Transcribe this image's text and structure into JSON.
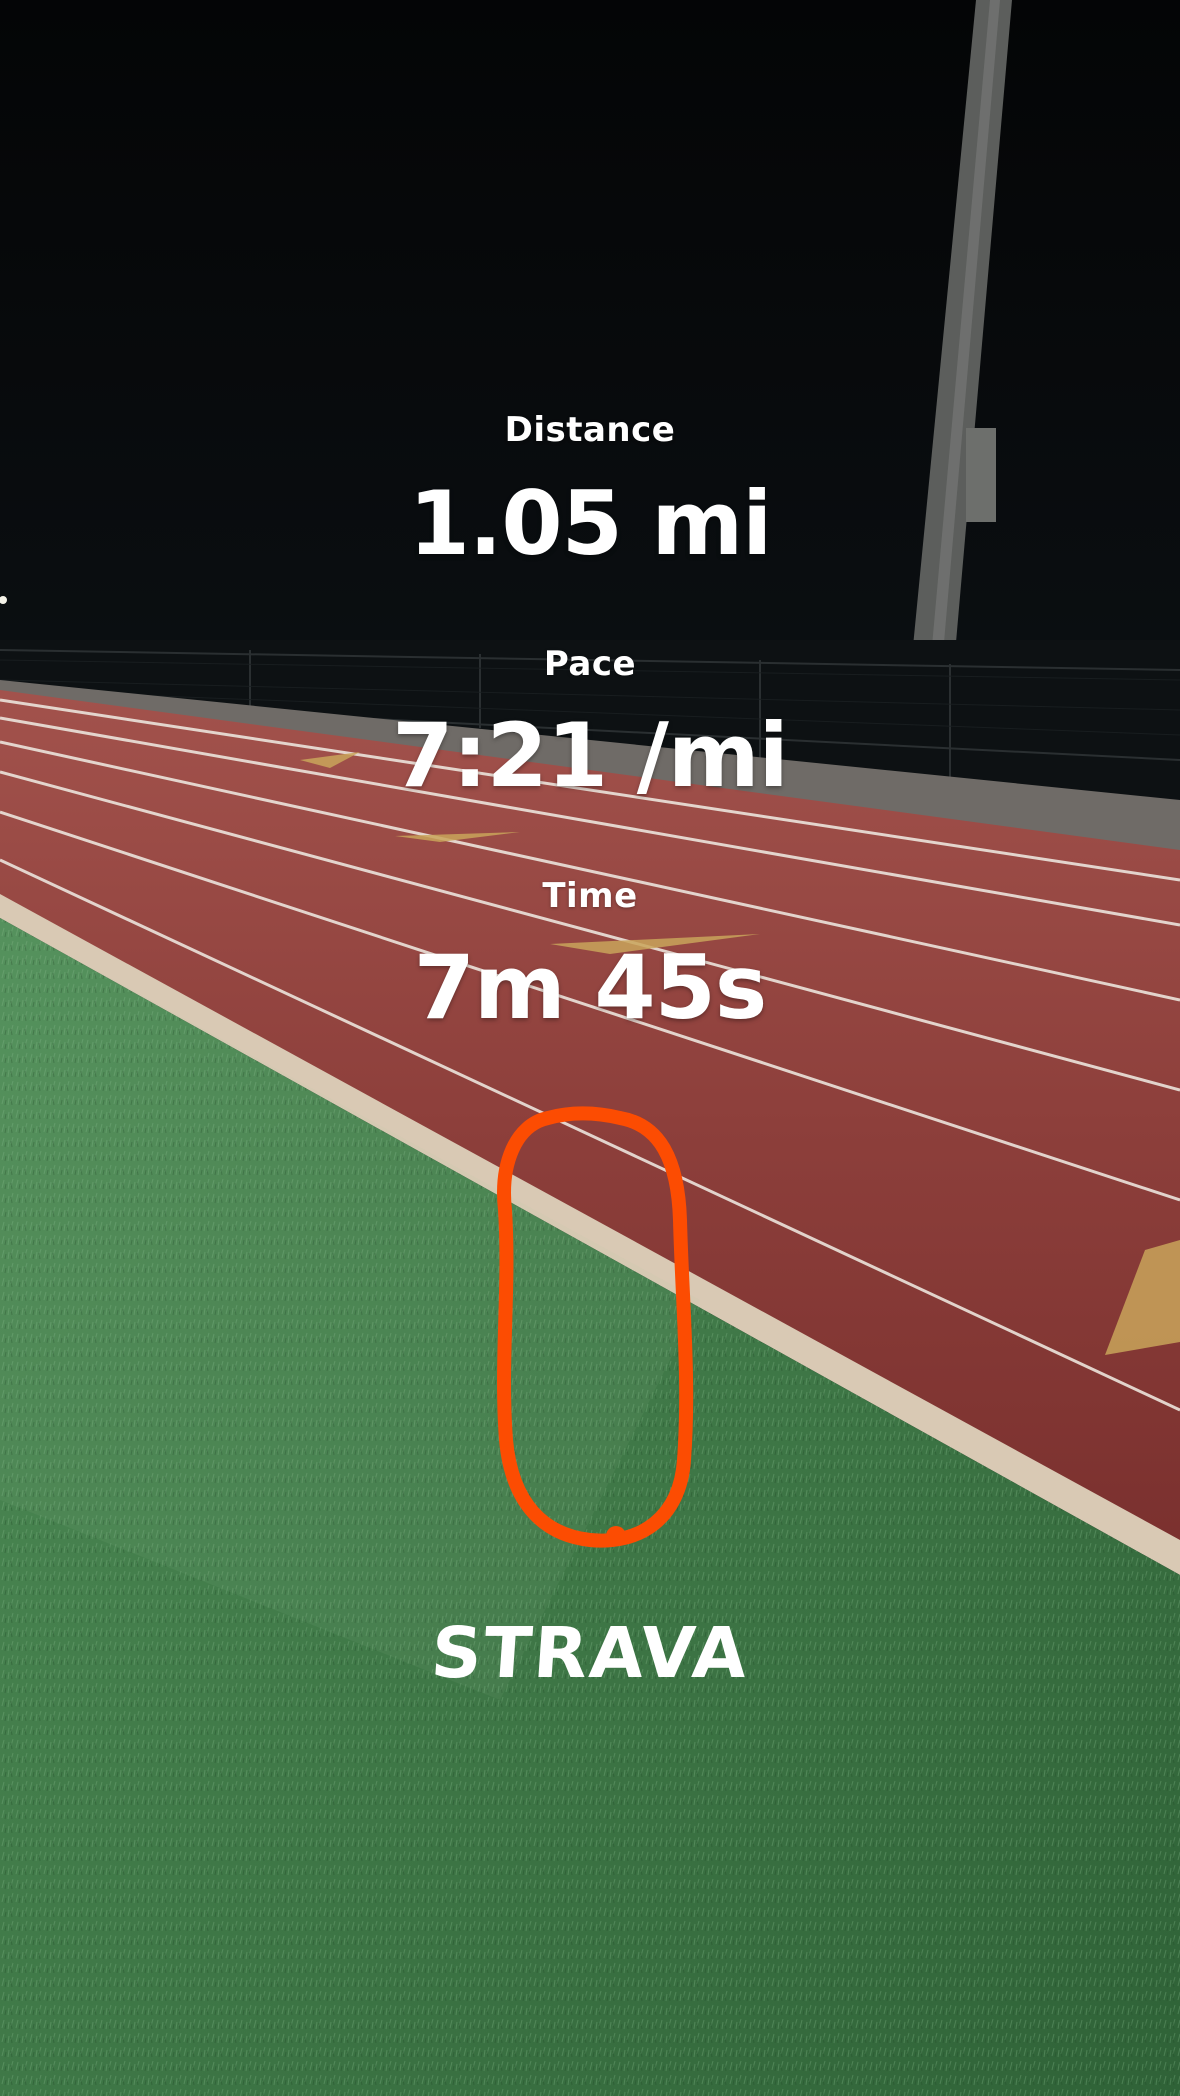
{
  "stats": {
    "distance": {
      "label": "Distance",
      "value": "1.05 mi"
    },
    "pace": {
      "label": "Pace",
      "value": "7:21 /mi"
    },
    "time": {
      "label": "Time",
      "value": "7m 45s"
    }
  },
  "route": {
    "color": "#fc4c02",
    "icon": "route-loop-icon"
  },
  "brand": {
    "name": "STRAVA"
  },
  "colors": {
    "sky": "#050708",
    "track": "#8a3a38",
    "turf": "#3f7a45",
    "lane_line": "#e9e2dc",
    "curb": "#d8c8b5"
  }
}
